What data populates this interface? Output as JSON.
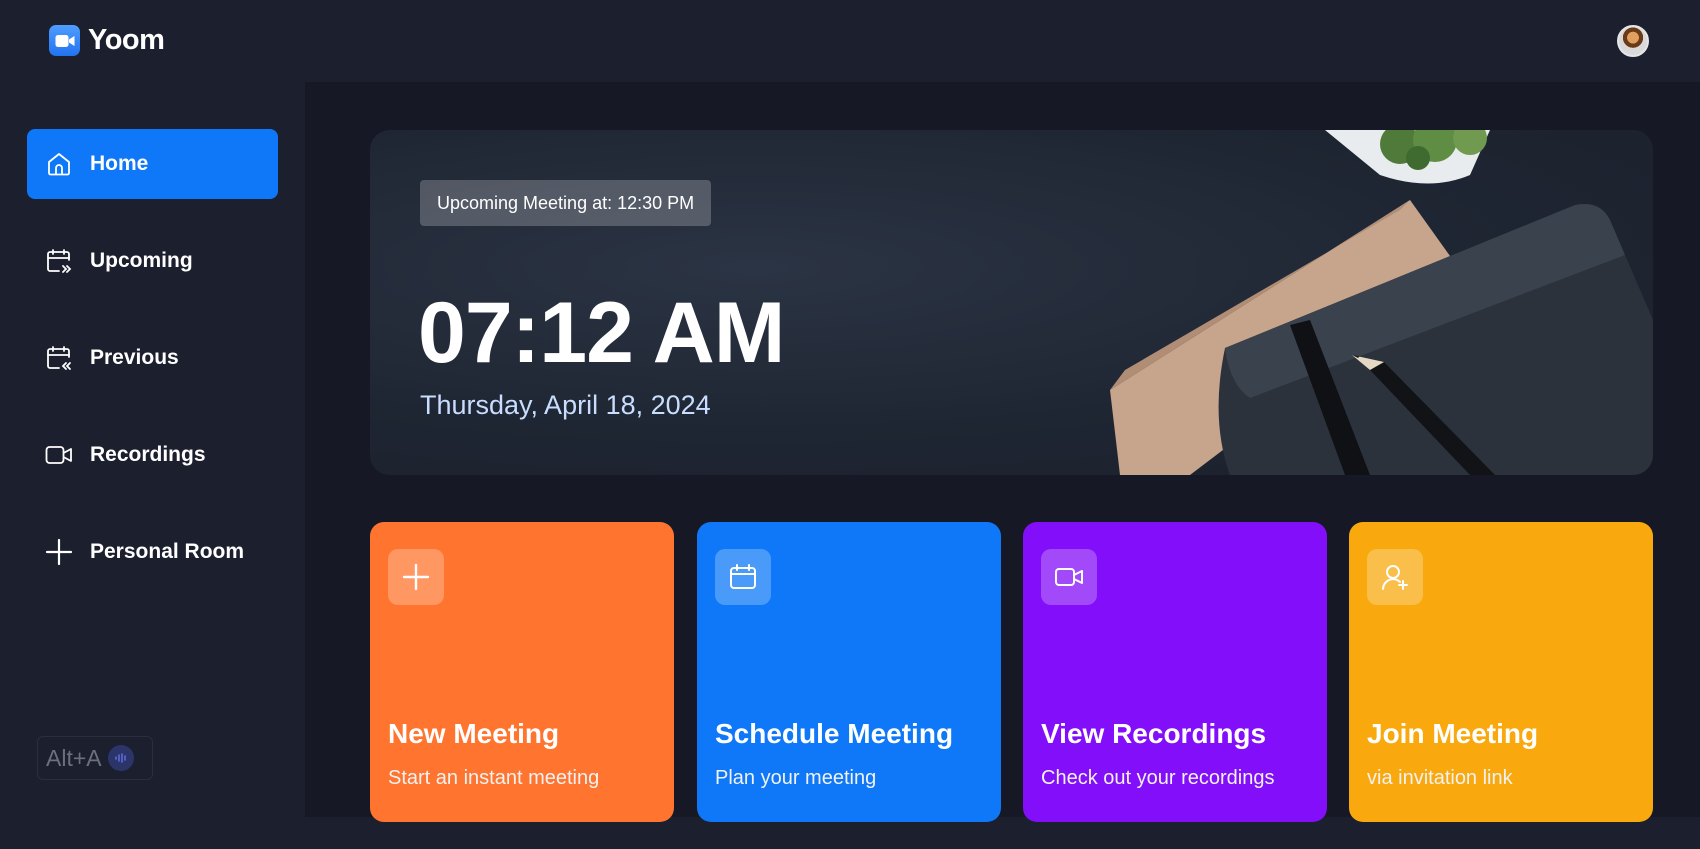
{
  "app": {
    "name": "Yoom",
    "logo_icon": "video-camera-icon",
    "user_avatar": "user-avatar"
  },
  "sidebar": {
    "items": [
      {
        "label": "Home",
        "icon": "home-icon",
        "active": true
      },
      {
        "label": "Upcoming",
        "icon": "calendar-forward-icon",
        "active": false
      },
      {
        "label": "Previous",
        "icon": "calendar-back-icon",
        "active": false
      },
      {
        "label": "Recordings",
        "icon": "video-icon",
        "active": false
      },
      {
        "label": "Personal Room",
        "icon": "plus-icon",
        "active": false
      }
    ],
    "shortcut_label": "Alt+A"
  },
  "hero": {
    "upcoming": "Upcoming Meeting at: 12:30 PM",
    "time": "07:12 AM",
    "date": "Thursday, April 18, 2024"
  },
  "cards": [
    {
      "title": "New Meeting",
      "subtitle": "Start an instant meeting",
      "icon": "plus-icon",
      "color": "#ff742e"
    },
    {
      "title": "Schedule Meeting",
      "subtitle": "Plan your meeting",
      "icon": "calendar-icon",
      "color": "#0e78f9"
    },
    {
      "title": "View Recordings",
      "subtitle": "Check out your recordings",
      "icon": "video-icon",
      "color": "#830ef9"
    },
    {
      "title": "Join Meeting",
      "subtitle": "via invitation link",
      "icon": "user-add-icon",
      "color": "#f9a90e"
    }
  ],
  "colors": {
    "background": "#161925",
    "panel": "#1c1f2e",
    "accent": "#0e78f9"
  }
}
